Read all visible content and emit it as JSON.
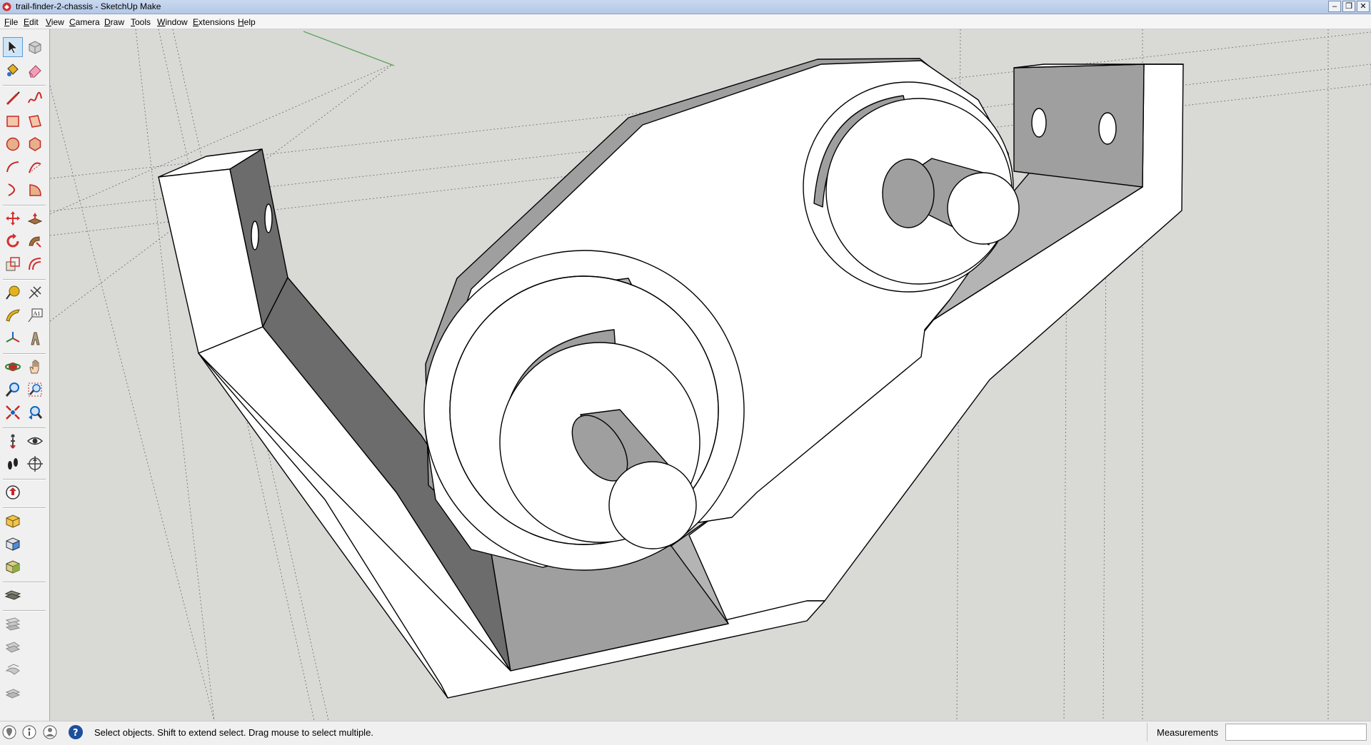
{
  "window": {
    "title": "trail-finder-2-chassis - SketchUp Make",
    "minimize_glyph": "–",
    "restore_glyph": "❐",
    "close_glyph": "✕"
  },
  "menu": {
    "items": [
      {
        "key": "F",
        "rest": "ile"
      },
      {
        "key": "E",
        "rest": "dit"
      },
      {
        "key": "V",
        "rest": "iew"
      },
      {
        "key": "C",
        "rest": "amera"
      },
      {
        "key": "D",
        "rest": "raw"
      },
      {
        "key": "T",
        "rest": "ools"
      },
      {
        "key": "W",
        "rest": "indow"
      },
      {
        "key": "E",
        "rest": "xtensions"
      },
      {
        "key": "H",
        "rest": "elp"
      }
    ]
  },
  "toolbar": {
    "text_tool_glyph": "A1",
    "tools": [
      {
        "name": "select-tool-icon",
        "color": "#1f1f1f"
      },
      {
        "name": "make-component-icon",
        "color": "#9c9c9c"
      },
      {
        "name": "paint-bucket-icon",
        "color": "#e4b21c"
      },
      {
        "name": "eraser-icon",
        "color": "#e06a8c"
      },
      {
        "name": "line-tool-icon",
        "color": "#c62828"
      },
      {
        "name": "freehand-tool-icon",
        "color": "#c62828"
      },
      {
        "name": "rectangle-tool-icon",
        "color": "#c62828"
      },
      {
        "name": "rotated-rectangle-icon",
        "color": "#c62828"
      },
      {
        "name": "circle-tool-icon",
        "color": "#c62828"
      },
      {
        "name": "polygon-tool-icon",
        "color": "#c62828"
      },
      {
        "name": "arc-tool-icon",
        "color": "#c62828"
      },
      {
        "name": "two-point-arc-icon",
        "color": "#c62828"
      },
      {
        "name": "three-point-arc-icon",
        "color": "#c62828"
      },
      {
        "name": "pie-tool-icon",
        "color": "#c62828"
      },
      {
        "name": "move-tool-icon",
        "color": "#d32f2f"
      },
      {
        "name": "push-pull-icon",
        "color": "#8d5a2b"
      },
      {
        "name": "rotate-tool-icon",
        "color": "#d32f2f"
      },
      {
        "name": "follow-me-icon",
        "color": "#8d5a2b"
      },
      {
        "name": "scale-tool-icon",
        "color": "#d32f2f"
      },
      {
        "name": "offset-tool-icon",
        "color": "#d32f2f"
      },
      {
        "name": "tape-measure-icon",
        "color": "#e4b21c"
      },
      {
        "name": "dimension-tool-icon",
        "color": "#3a3a3a"
      },
      {
        "name": "protractor-icon",
        "color": "#e4b21c"
      },
      {
        "name": "text-tool-icon",
        "color": "#3a3a3a"
      },
      {
        "name": "axes-tool-icon",
        "color": "#2e7d32"
      },
      {
        "name": "3d-text-icon",
        "color": "#8a7a5a"
      },
      {
        "name": "orbit-tool-icon",
        "color": "#c62828"
      },
      {
        "name": "pan-tool-icon",
        "color": "#7a5a3a"
      },
      {
        "name": "zoom-tool-icon",
        "color": "#1565c0"
      },
      {
        "name": "zoom-window-icon",
        "color": "#1565c0"
      },
      {
        "name": "zoom-extents-icon",
        "color": "#c62828"
      },
      {
        "name": "previous-view-icon",
        "color": "#1565c0"
      },
      {
        "name": "position-camera-icon",
        "color": "#444444"
      },
      {
        "name": "look-around-icon",
        "color": "#444444"
      },
      {
        "name": "walk-tool-icon",
        "color": "#222222"
      },
      {
        "name": "section-plane-icon",
        "color": "#444444"
      },
      {
        "name": "3d-warehouse-icon",
        "color": "#c62828"
      },
      {
        "name": "component-box-icon",
        "color": "#e4b21c"
      },
      {
        "name": "share-component-icon",
        "color": "#1565c0"
      },
      {
        "name": "extension-warehouse-icon",
        "color": "#6d8b2f"
      },
      {
        "name": "layers-icon",
        "color": "#6f6f5f"
      },
      {
        "name": "sandbox-from-contours-icon",
        "color": "#9a9a9a"
      },
      {
        "name": "sandbox-from-scratch-icon",
        "color": "#9a9a9a"
      },
      {
        "name": "sandbox-smoove-icon",
        "color": "#9a9a9a"
      },
      {
        "name": "sandbox-stamp-icon",
        "color": "#9a9a9a"
      }
    ]
  },
  "viewport": {
    "background": "#d9d9d6",
    "face_white": "#ffffff",
    "face_light_gray": "#b4b4b4",
    "face_mid_gray": "#9f9f9f",
    "face_dark_gray": "#6c6c6c",
    "edge_color": "#000000",
    "green_axis": "#4a9a4a"
  },
  "status": {
    "hint": "Select objects. Shift to extend select. Drag mouse to select multiple.",
    "measurements_label": "Measurements",
    "measurements_value": ""
  }
}
